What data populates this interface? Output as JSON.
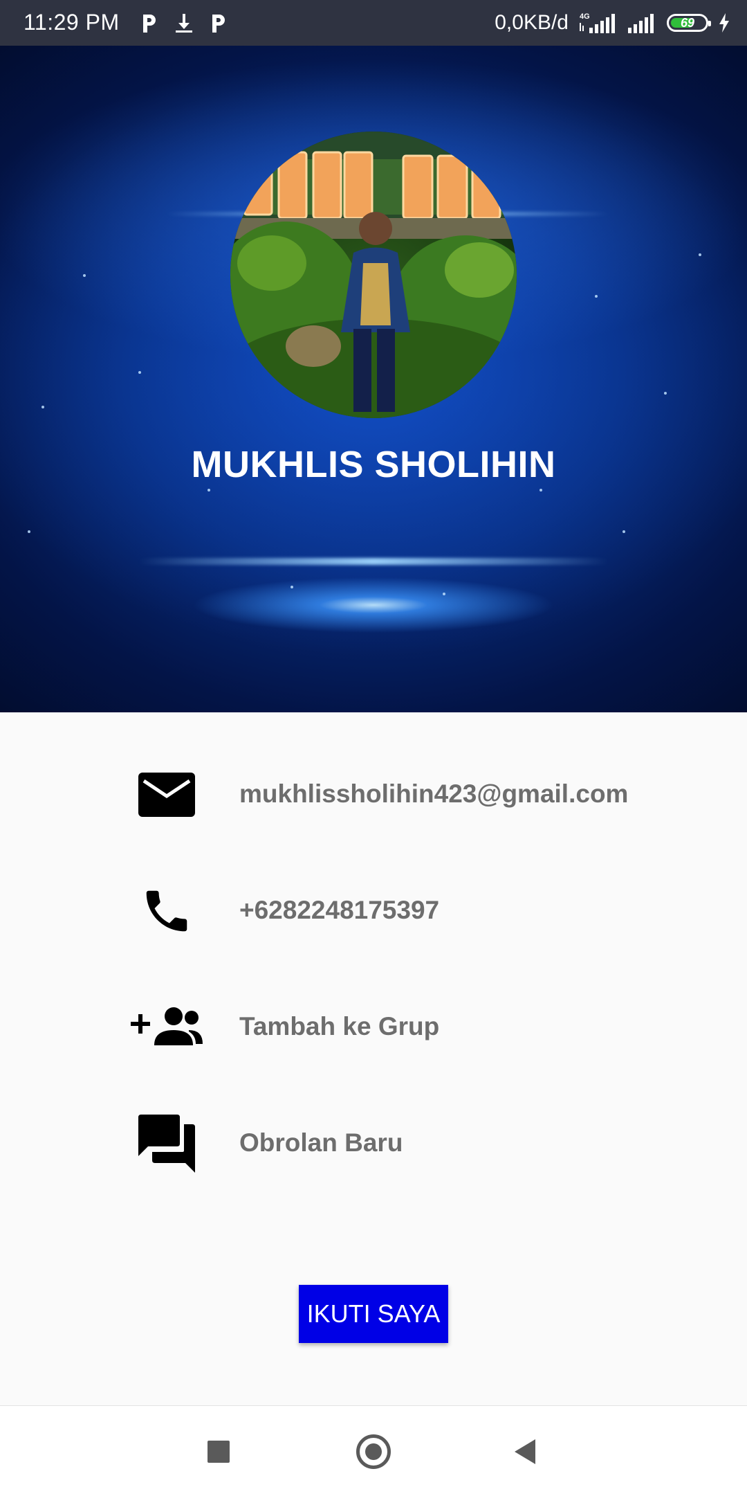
{
  "status_bar": {
    "time": "11:29 PM",
    "network_speed": "0,0KB/d",
    "network_type": "4G",
    "battery_level": "69",
    "battery_percent": 69,
    "icons": [
      "parking-app-icon",
      "download-icon",
      "parking-app-icon",
      "signal-icon",
      "signal-icon",
      "battery-icon",
      "charging-icon"
    ]
  },
  "profile": {
    "name": "MUKHLIS SHOLIHIN",
    "photo_icon": "profile-photo"
  },
  "contact_rows": [
    {
      "icon": "email-icon",
      "text": "mukhlissholihin423@gmail.com"
    },
    {
      "icon": "phone-icon",
      "text": "+6282248175397"
    },
    {
      "icon": "group-add-icon",
      "text": "Tambah ke Grup"
    },
    {
      "icon": "chat-icon",
      "text": "Obrolan Baru"
    }
  ],
  "follow_button": {
    "label": "IKUTI SAYA"
  },
  "colors": {
    "status_bar": "#2f3341",
    "button": "#0000e6",
    "text_gray": "#6d6d6d",
    "battery_green": "#2fbd3a"
  },
  "nav_bar": {
    "icons": [
      "recent-apps-icon",
      "home-icon",
      "back-icon"
    ]
  }
}
